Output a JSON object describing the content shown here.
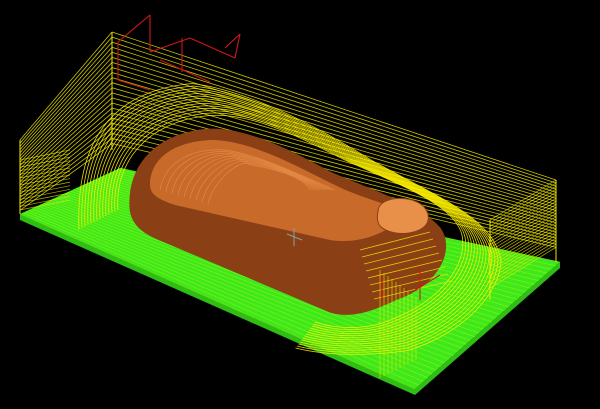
{
  "viewport": {
    "background": "#000000",
    "view": "isometric"
  },
  "scene": {
    "stock_base_color": "#3fe81c",
    "stock_base_dark_color": "#2fbf14",
    "stock_edge_color": "#b8ff00",
    "toolpath_color": "#f0e800",
    "toolpath_ramp_color": "#fff200",
    "part_color": "#c86a2a",
    "part_highlight_color": "#e8904a",
    "part_shadow_color": "#8a3f14",
    "tool_marker_color": "#d01818",
    "origin_marker_color": "#88a0a0"
  }
}
